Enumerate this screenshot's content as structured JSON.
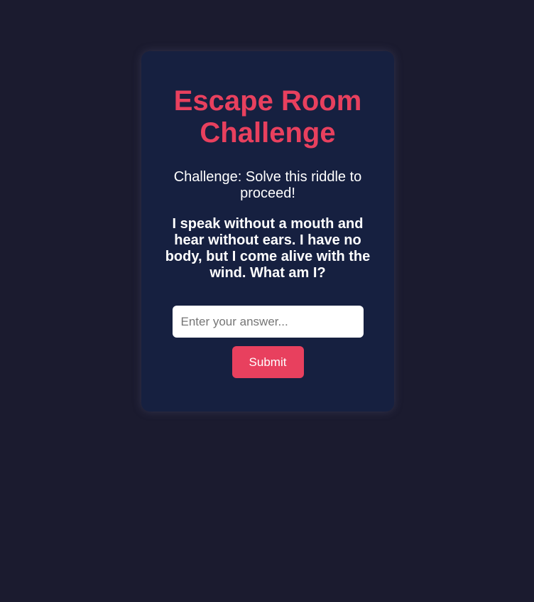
{
  "card": {
    "title": "Escape Room Challenge",
    "prompt": "Challenge: Solve this riddle to proceed!",
    "riddle": "I speak without a mouth and hear without ears. I have no body, but I come alive with the wind. What am I?"
  },
  "form": {
    "answer_value": "",
    "answer_placeholder": "Enter your answer...",
    "submit_label": "Submit"
  },
  "colors": {
    "page_background": "#1b1b2f",
    "card_background": "#162040",
    "accent": "#e8405e",
    "text": "#ffffff"
  }
}
